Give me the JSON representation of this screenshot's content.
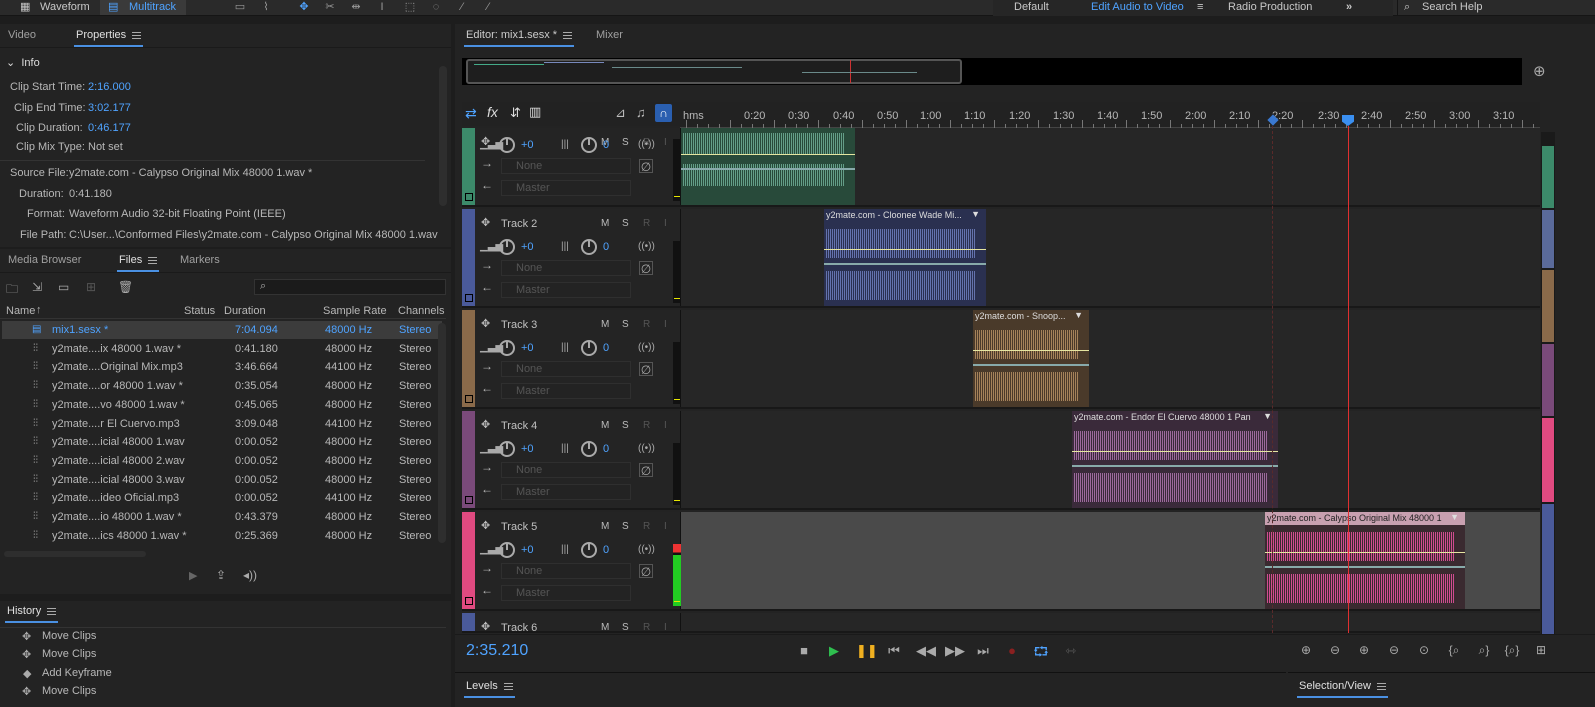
{
  "topbar": {
    "waveform": "Waveform",
    "multitrack": "Multitrack",
    "workspaces": [
      "Default",
      "Edit Audio to Video",
      "Radio Production"
    ],
    "search": "Search Help"
  },
  "props": {
    "tabs": [
      "Video",
      "Properties"
    ],
    "section": "Info",
    "fields": [
      {
        "label": "Clip Start Time:",
        "value": "2:16.000"
      },
      {
        "label": "Clip End Time:",
        "value": "3:02.177"
      },
      {
        "label": "Clip Duration:",
        "value": "0:46.177"
      },
      {
        "label": "Clip Mix Type:",
        "value": "Not set"
      }
    ],
    "source": [
      {
        "label": "Source File:",
        "value": "y2mate.com - Calypso Original Mix 48000 1.wav *"
      },
      {
        "label": "Duration:",
        "value": "0:41.180"
      },
      {
        "label": "Format:",
        "value": "Waveform Audio 32-bit Floating Point (IEEE)"
      },
      {
        "label": "File Path:",
        "value": "C:\\User...\\Conformed Files\\y2mate.com - Calypso Original Mix 48000 1.wav"
      }
    ]
  },
  "files": {
    "tabs": [
      "Media Browser",
      "Files",
      "Markers"
    ],
    "search_placeholder": "",
    "columns": [
      "Name",
      "Status",
      "Duration",
      "Sample Rate",
      "Channels"
    ],
    "rows": [
      [
        "mix1.sesx *",
        "",
        "7:04.094",
        "48000 Hz",
        "Stereo"
      ],
      [
        "y2mate....ix 48000 1.wav *",
        "",
        "0:41.180",
        "48000 Hz",
        "Stereo"
      ],
      [
        "y2mate....Original Mix.mp3",
        "",
        "3:46.664",
        "44100 Hz",
        "Stereo"
      ],
      [
        "y2mate....or 48000 1.wav *",
        "",
        "0:35.054",
        "48000 Hz",
        "Stereo"
      ],
      [
        "y2mate....vo 48000 1.wav *",
        "",
        "0:45.065",
        "48000 Hz",
        "Stereo"
      ],
      [
        "y2mate....r  El Cuervo.mp3",
        "",
        "3:09.048",
        "44100 Hz",
        "Stereo"
      ],
      [
        "y2mate....icial 48000 1.wav",
        "",
        "0:00.052",
        "48000 Hz",
        "Stereo"
      ],
      [
        "y2mate....icial 48000 2.wav",
        "",
        "0:00.052",
        "48000 Hz",
        "Stereo"
      ],
      [
        "y2mate....icial 48000 3.wav",
        "",
        "0:00.052",
        "48000 Hz",
        "Stereo"
      ],
      [
        "y2mate....ideo Oficial.mp3",
        "",
        "0:00.052",
        "44100 Hz",
        "Stereo"
      ],
      [
        "y2mate....io 48000 1.wav *",
        "",
        "0:43.379",
        "48000 Hz",
        "Stereo"
      ],
      [
        "y2mate....ics 48000 1.wav *",
        "",
        "0:25.369",
        "48000 Hz",
        "Stereo"
      ]
    ]
  },
  "history": {
    "title": "History",
    "items": [
      "Move Clips",
      "Move Clips",
      "Add Keyframe",
      "Move Clips"
    ]
  },
  "editor": {
    "tabs": [
      "Editor: mix1.sesx *",
      "Mixer"
    ],
    "time": "2:35.210",
    "ruler": [
      "hms",
      "0:20",
      "0:30",
      "0:40",
      "0:50",
      "1:00",
      "1:10",
      "1:20",
      "1:30",
      "1:40",
      "1:50",
      "2:00",
      "2:10",
      "2:20",
      "2:30",
      "2:40",
      "2:50",
      "3:00",
      "3:10"
    ],
    "tracks": [
      {
        "name": "",
        "vol": "+0",
        "pan": "0",
        "input": "None",
        "output": "Master",
        "color": "#3c8a6a",
        "clip": ""
      },
      {
        "name": "Track 2",
        "vol": "+0",
        "pan": "0",
        "input": "None",
        "output": "Master",
        "color": "#4a5a9a",
        "clip": "y2mate.com - Cloonee  Wade  Mi..."
      },
      {
        "name": "Track 3",
        "vol": "+0",
        "pan": "0",
        "input": "None",
        "output": "Master",
        "color": "#8a6a4a",
        "clip": "y2mate.com - Snoop..."
      },
      {
        "name": "Track 4",
        "vol": "+0",
        "pan": "0",
        "input": "None",
        "output": "Master",
        "color": "#7a4a7a",
        "clip": "y2mate.com - Endor  El Cuervo 48000 1     Pan"
      },
      {
        "name": "Track 5",
        "vol": "+0",
        "pan": "0",
        "input": "None",
        "output": "Master",
        "color": "#e04a80",
        "clip": "y2mate.com - Calypso Original Mix 48000 1"
      },
      {
        "name": "Track 6"
      }
    ],
    "msr": [
      "M",
      "S",
      "R",
      "I"
    ]
  },
  "bottom": {
    "levels": "Levels",
    "selection": "Selection/View"
  }
}
